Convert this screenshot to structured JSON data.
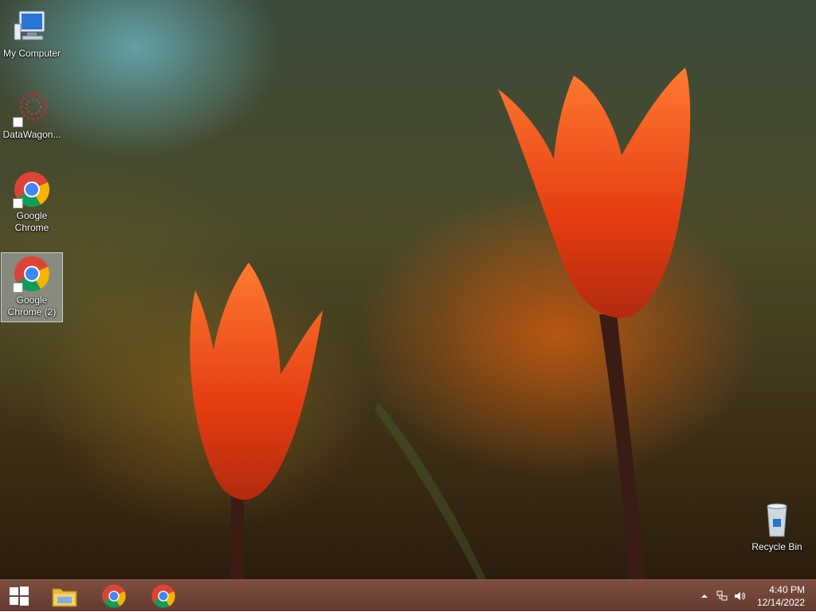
{
  "desktop": {
    "icons": [
      {
        "label": "My Computer",
        "icon": "computer-icon"
      },
      {
        "label": "DataWagon...",
        "icon": "datawagon-icon"
      },
      {
        "label": "Google Chrome",
        "icon": "chrome-icon"
      },
      {
        "label": "Google Chrome (2)",
        "icon": "chrome-icon",
        "selected": true
      },
      {
        "label": "Recycle Bin",
        "icon": "recycle-bin-icon"
      }
    ]
  },
  "taskbar": {
    "start": {
      "icon": "windows-start-icon"
    },
    "pinned": [
      {
        "icon": "file-explorer-icon"
      },
      {
        "icon": "chrome-icon"
      },
      {
        "icon": "chrome-icon"
      }
    ],
    "tray": {
      "icons": [
        "show-hidden-icons-chevron",
        "network-icon",
        "volume-icon"
      ],
      "time": "4:40 PM",
      "date": "12/14/2022"
    }
  },
  "colors": {
    "taskbar": "#6e4034",
    "tulip": "#e84a14",
    "selection": "#c8d7eb"
  }
}
